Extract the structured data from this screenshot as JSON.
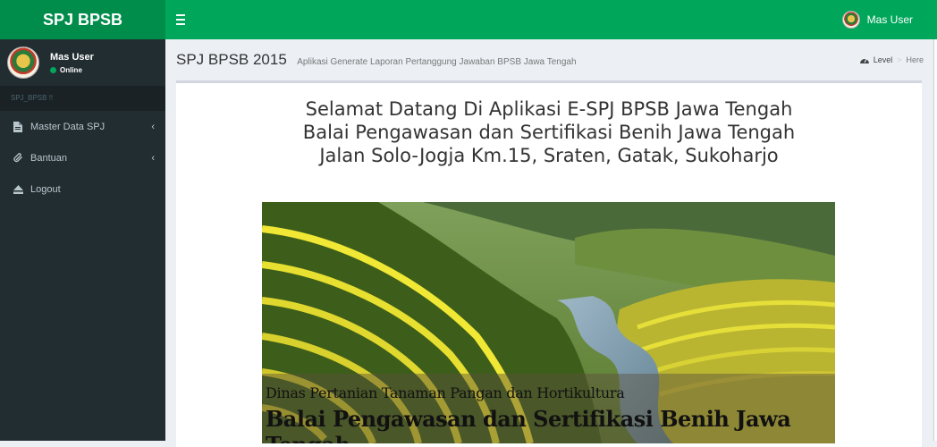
{
  "header": {
    "logo": "SPJ BPSB",
    "user_name": "Mas User",
    "colors": {
      "logo_bg": "#008d4c",
      "navbar_bg": "#00a65a"
    }
  },
  "sidebar": {
    "user_name": "Mas User",
    "status": "Online",
    "section_header": "SPJ_BPSB !!",
    "items": [
      {
        "label": "Master Data SPJ",
        "icon": "file-icon",
        "has_submenu": true
      },
      {
        "label": "Bantuan",
        "icon": "paperclip-icon",
        "has_submenu": true
      },
      {
        "label": "Logout",
        "icon": "eject-icon",
        "has_submenu": false
      }
    ]
  },
  "content": {
    "title": "SPJ BPSB 2015",
    "subtitle": "Aplikasi Generate Laporan Pertanggung Jawaban BPSB Jawa Tengah",
    "breadcrumb": {
      "level": "Level",
      "separator": ">",
      "here": "Here"
    },
    "welcome_lines": [
      "Selamat Datang Di Aplikasi E-SPJ BPSB Jawa Tengah",
      "Balai Pengawasan dan Sertifikasi Benih Jawa Tengah",
      "Jalan Solo-Jogja Km.15, Sraten, Gatak, Sukoharjo"
    ],
    "banner": {
      "caption_line1": "Dinas Pertanian Tanaman Pangan dan Hortikultura",
      "caption_line2": "Balai Pengawasan dan Sertifikasi Benih Jawa Tengah"
    }
  }
}
